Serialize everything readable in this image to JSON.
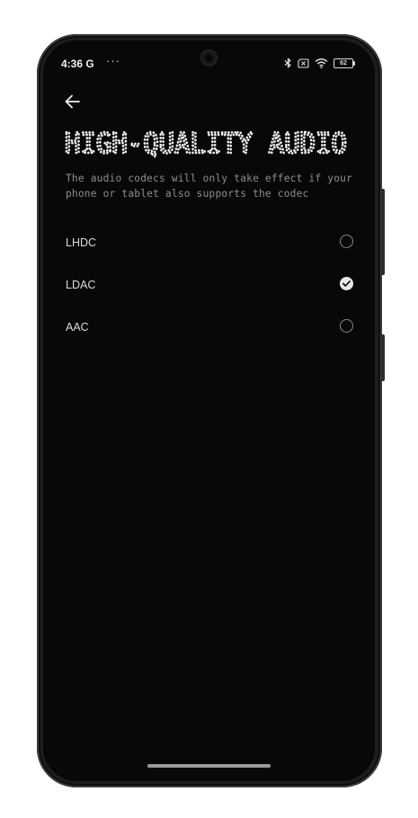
{
  "status_bar": {
    "time": "4:36",
    "carrier_icon": "G",
    "overflow": "···",
    "icons": [
      "bluetooth-icon",
      "no-sim-icon",
      "wifi-icon"
    ],
    "battery": "62"
  },
  "header": {
    "back_icon": "arrow-left-icon",
    "title": "HIGH-QUALITY AUDIO"
  },
  "description": "The audio codecs will only take effect if your phone or tablet also supports the codec",
  "options": [
    {
      "label": "LHDC",
      "selected": false
    },
    {
      "label": "LDAC",
      "selected": true
    },
    {
      "label": "AAC",
      "selected": false
    }
  ]
}
